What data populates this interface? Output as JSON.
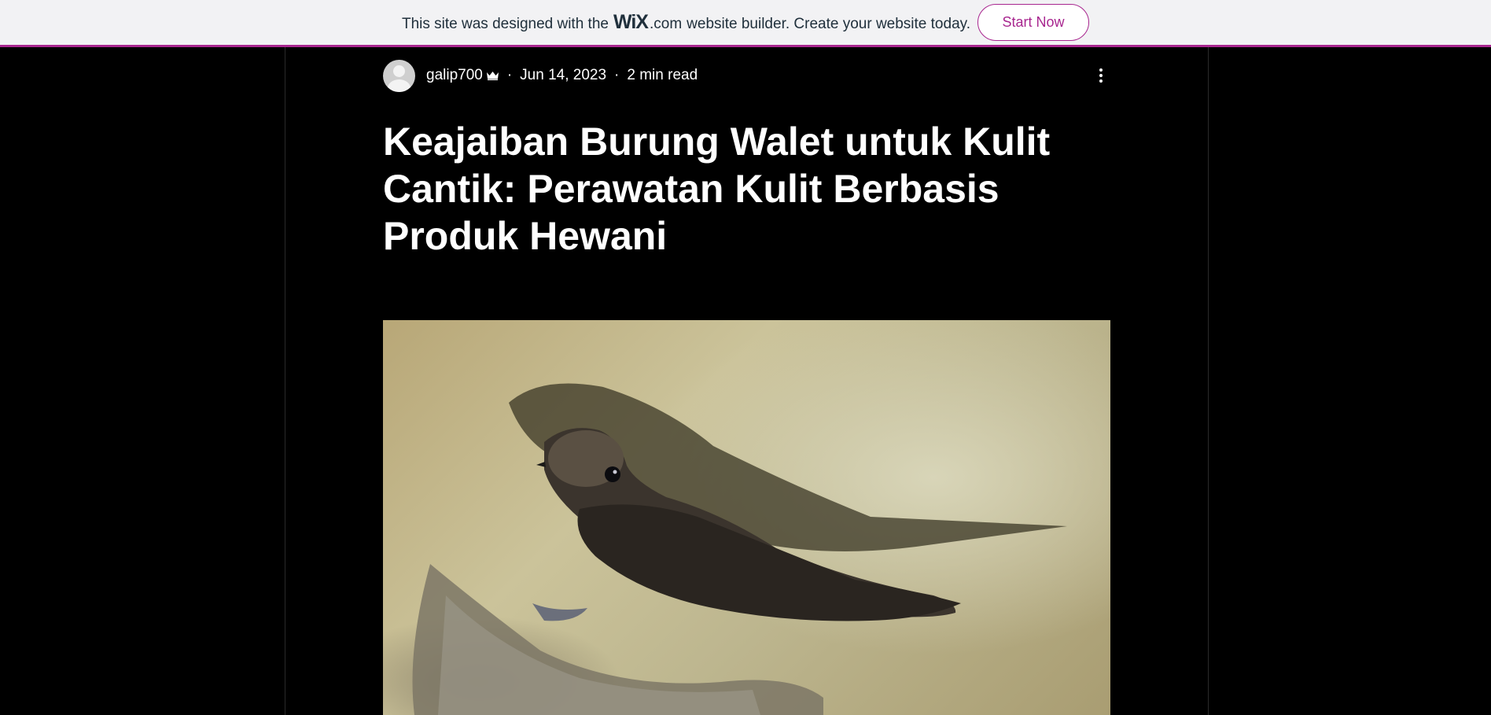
{
  "banner": {
    "prefix": "This site was designed with the",
    "logo": "WiX",
    "dotcom": ".com",
    "suffix": "website builder. Create your website today.",
    "cta": "Start Now",
    "accent": "#a8268f"
  },
  "post": {
    "author": "galip700",
    "separator": "·",
    "date": "Jun 14, 2023",
    "read_time": "2 min read",
    "title": "Keajaiban Burung Walet untuk Kulit Cantik: Perawatan Kulit Berbasis Produk Hewani",
    "icons": {
      "avatar": "user-avatar-icon",
      "admin": "crown-icon",
      "more": "more-vertical-icon"
    },
    "hero_image": "swiftlet-bird-photo"
  }
}
